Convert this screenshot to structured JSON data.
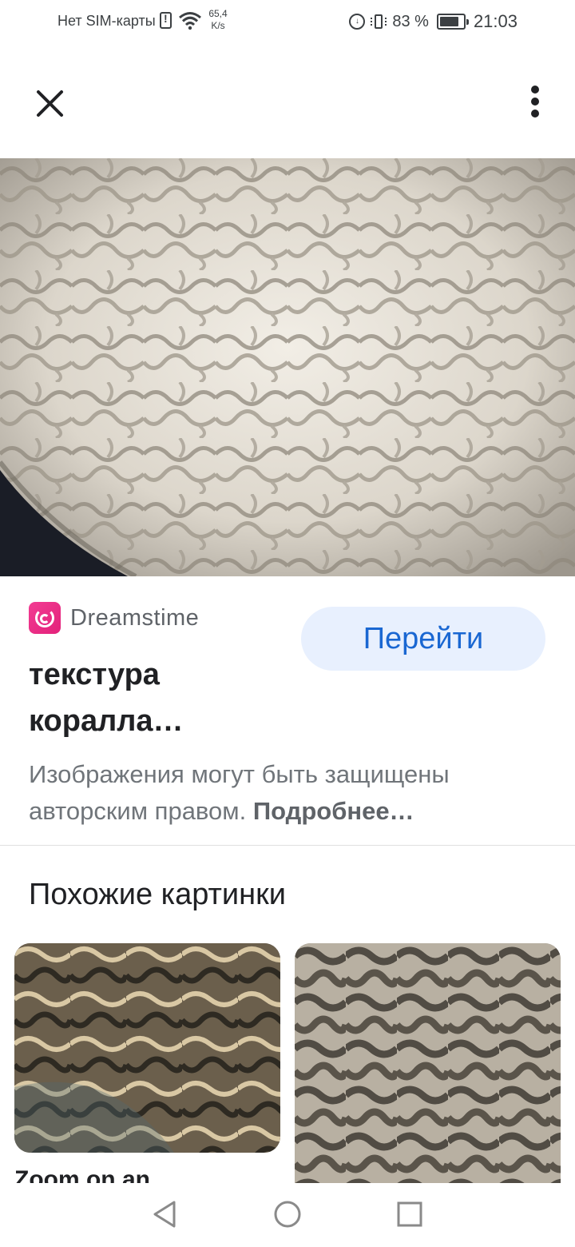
{
  "status_bar": {
    "carrier": "Нет SIM-карты",
    "speed_value": "65,4",
    "speed_unit": "K/s",
    "battery_percent": "83 %",
    "battery_level": 0.83,
    "time": "21:03",
    "icons": [
      "sim-alert-icon",
      "wifi-icon",
      "data-saver-icon",
      "vibrate-icon",
      "battery-icon"
    ]
  },
  "top_bar": {
    "close_icon": "close-icon",
    "more_icon": "more-vert-icon"
  },
  "main_image": {
    "alt": "текстура коралла",
    "colors": {
      "background": "#1a1d26",
      "coral": "#e8e3da"
    }
  },
  "info": {
    "source_name": "Dreamstime",
    "visit_label": "Перейти",
    "title_line1": "текстура",
    "title_line2": "коралла…",
    "copyright_text": "Изображения могут быть защищены авторским правом.",
    "learn_more": "Подробнее…"
  },
  "related": {
    "heading": "Похожие картинки",
    "items": [
      {
        "caption": "Zoom on an Oulophyllia"
      },
      {
        "caption": ""
      }
    ]
  },
  "colors": {
    "accent": "#1a67d2",
    "button_bg": "#e8f0fe",
    "text_primary": "#202124",
    "text_secondary": "#70757a"
  }
}
